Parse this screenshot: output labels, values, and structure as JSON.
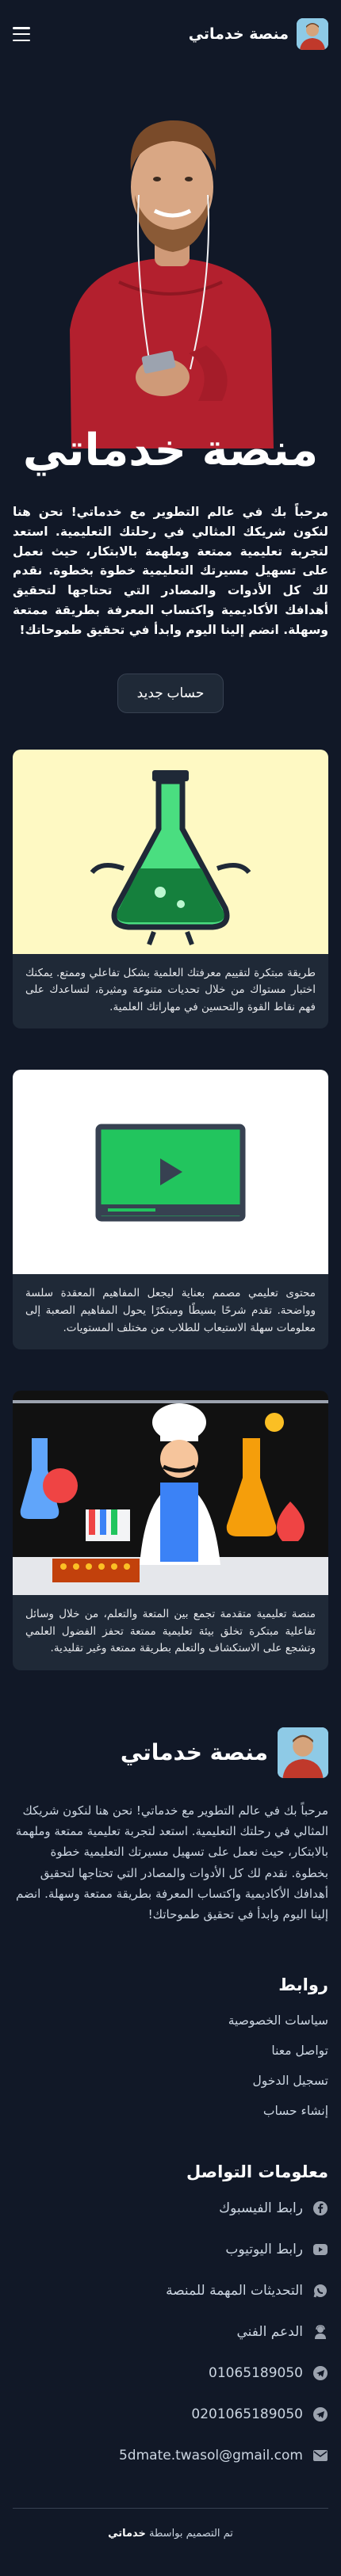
{
  "nav": {
    "brand": "منصة خدماتي"
  },
  "hero": {
    "title": "منصة خدماتي"
  },
  "intro": {
    "text": "مرحباً بك في عالم التطوير مع خدماتي! نحن هنا لنكون شريكك المثالي في رحلتك التعليمية. استعد لتجربة تعليمية ممتعة وملهمة بالابتكار، حيث نعمل على تسهيل مسيرتك التعليمية خطوة بخطوة. نقدم لك كل الأدوات والمصادر التي تحتاجها لتحقيق أهدافك الأكاديمية واكتساب المعرفة بطريقة ممتعة وسهلة. انضم إلينا اليوم وابدأ في تحقيق طموحاتك!"
  },
  "cta": {
    "label": "حساب جديد"
  },
  "cards": [
    {
      "text": "طريقة مبتكرة لتقييم معرفتك العلمية بشكل تفاعلي وممتع. يمكنك اختبار مستواك من خلال تحديات متنوعة ومثيرة، لتساعدك على فهم نقاط القوة والتحسين في مهاراتك العلمية."
    },
    {
      "text": "محتوى تعليمي مصمم بعناية ليجعل المفاهيم المعقدة سلسة وواضحة. تقدم شرحًا بسيطًا ومبتكرًا يحول المفاهيم الصعبة إلى معلومات سهلة الاستيعاب للطلاب من مختلف المستويات."
    },
    {
      "text": "منصة تعليمية متقدمة تجمع بين المتعة والتعلم، من خلال وسائل تفاعلية مبتكرة تخلق بيئة تعليمية ممتعة تحفز الفضول العلمي وتشجع على الاستكشاف والتعلم بطريقة ممتعة وغير تقليدية."
    }
  ],
  "footer": {
    "brand": "منصة خدماتي",
    "about": "مرحباً بك في عالم التطوير مع خدماتي! نحن هنا لنكون شريكك المثالي في رحلتك التعليمية. استعد لتجربة تعليمية ممتعة وملهمة بالابتكار، حيث نعمل على تسهيل مسيرتك التعليمية خطوة بخطوة. نقدم لك كل الأدوات والمصادر التي تحتاجها لتحقيق أهدافك الأكاديمية واكتساب المعرفة بطريقة ممتعة وسهلة. انضم إلينا اليوم وابدأ في تحقيق طموحاتك!",
    "links_title": "روابط",
    "links": [
      "سياسات الخصوصية",
      "تواصل معنا",
      "تسجيل الدخول",
      "إنشاء حساب"
    ],
    "contact_title": "معلومات التواصل",
    "contact": [
      {
        "label": "رابط الفيسبوك",
        "icon": "facebook-icon"
      },
      {
        "label": "رابط اليوتيوب",
        "icon": "youtube-icon"
      },
      {
        "label": "التحديثات المهمة للمنصة",
        "icon": "whatsapp-icon"
      },
      {
        "label": "الدعم الفني",
        "icon": "support-agent-icon"
      },
      {
        "label": "01065189050",
        "icon": "telegram-icon"
      },
      {
        "label": "0201065189050",
        "icon": "telegram-icon"
      },
      {
        "label": "5dmate.twasol@gmail.com",
        "icon": "email-icon"
      }
    ],
    "copyright_prefix": "تم التصميم بواسطة",
    "copyright_brand": "خدماتي"
  },
  "colors": {
    "background": "#111827",
    "card": "#1f2937",
    "card1_bg": "#fef9c3",
    "card3_bg": "#111111",
    "accent_green": "#22c55e"
  }
}
